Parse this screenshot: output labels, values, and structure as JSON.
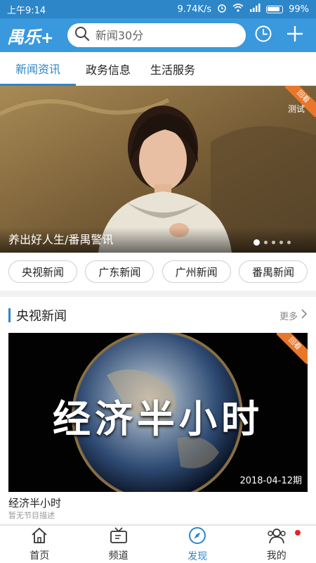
{
  "status": {
    "time": "上午9:14",
    "speed": "9.74K/s",
    "battery": "99%"
  },
  "header": {
    "logo": "禺乐",
    "logo_plus": "+",
    "search_placeholder": "新闻30分"
  },
  "tabs": [
    {
      "label": "新闻资讯",
      "active": true
    },
    {
      "label": "政务信息",
      "active": false
    },
    {
      "label": "生活服务",
      "active": false
    }
  ],
  "banner": {
    "caption": "养出好人生/番禺警讯",
    "badge": "回看",
    "corner_text": "测试",
    "page_count": 5,
    "current_page": 1
  },
  "categories": [
    "央视新闻",
    "广东新闻",
    "广州新闻",
    "番禺新闻"
  ],
  "section": {
    "title": "央视新闻",
    "more": "更多"
  },
  "card": {
    "badge": "回看",
    "title": "经济半小时",
    "description": "暂无节目描述",
    "date": "2018-04-12期",
    "image_text": "经济半小时"
  },
  "bottom_nav": [
    {
      "label": "首页",
      "icon": "home-icon"
    },
    {
      "label": "频道",
      "icon": "tv-icon"
    },
    {
      "label": "发现",
      "icon": "compass-icon",
      "active": true
    },
    {
      "label": "我的",
      "icon": "users-icon",
      "notification": true
    }
  ],
  "colors": {
    "primary": "#3a98dd",
    "accent": "#2d86c8",
    "badge": "#e9772a",
    "notify": "#e52323"
  }
}
